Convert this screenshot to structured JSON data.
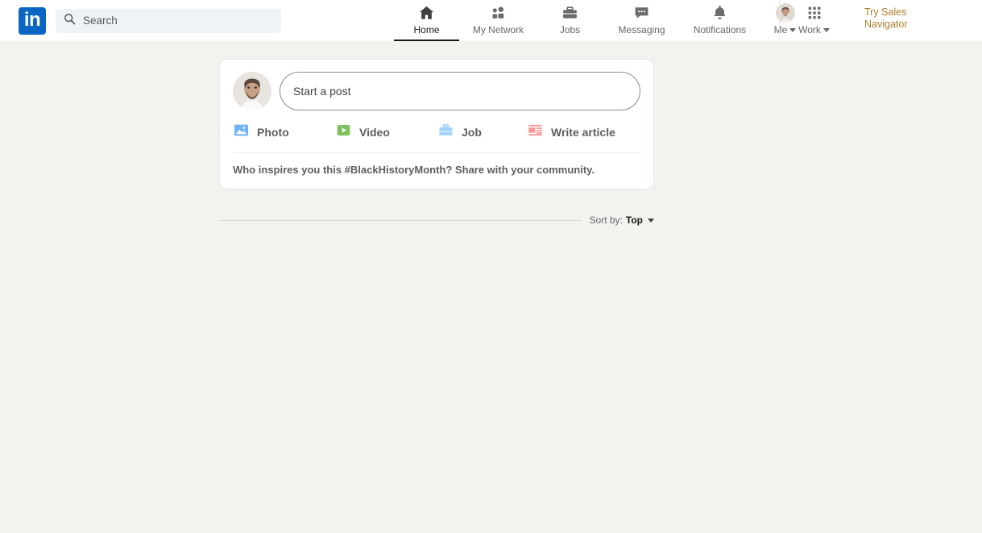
{
  "header": {
    "logo_text": "in",
    "logo_color": "#0a66c2",
    "search": {
      "placeholder": "Search",
      "value": "",
      "icon": "search-icon"
    },
    "nav_items": [
      {
        "label": "Home",
        "icon": "home-icon",
        "active": true
      },
      {
        "label": "My Network",
        "icon": "people-icon",
        "active": false
      },
      {
        "label": "Jobs",
        "icon": "briefcase-icon",
        "active": false
      },
      {
        "label": "Messaging",
        "icon": "message-bubble-icon",
        "active": false
      },
      {
        "label": "Notifications",
        "icon": "bell-icon",
        "active": false
      },
      {
        "label": "Me",
        "icon": "avatar-icon",
        "active": false,
        "has_caret": true
      },
      {
        "label": "Work",
        "icon": "grid-icon",
        "active": false,
        "has_caret": true
      }
    ],
    "try_sales_navigator": {
      "line1": "Try Sales",
      "line2": "Navigator",
      "color": "#b07d2b"
    }
  },
  "composer": {
    "avatar": "user-avatar",
    "start_post_placeholder": "Start a post",
    "actions": [
      {
        "label": "Photo",
        "icon": "photo-icon",
        "color": "#70b5f9"
      },
      {
        "label": "Video",
        "icon": "video-icon",
        "color": "#7fc15e"
      },
      {
        "label": "Job",
        "icon": "job-briefcase-icon",
        "color": "#a0d2fb"
      },
      {
        "label": "Write article",
        "icon": "article-icon",
        "color": "#fc9295"
      }
    ],
    "prompt": "Who inspires you this #BlackHistoryMonth? Share with your community."
  },
  "feed": {
    "sort_label": "Sort by:",
    "sort_value": "Top"
  },
  "theme": {
    "page_background": "#f3f2ef",
    "card_background": "#ffffff",
    "accent": "#0a66c2"
  }
}
